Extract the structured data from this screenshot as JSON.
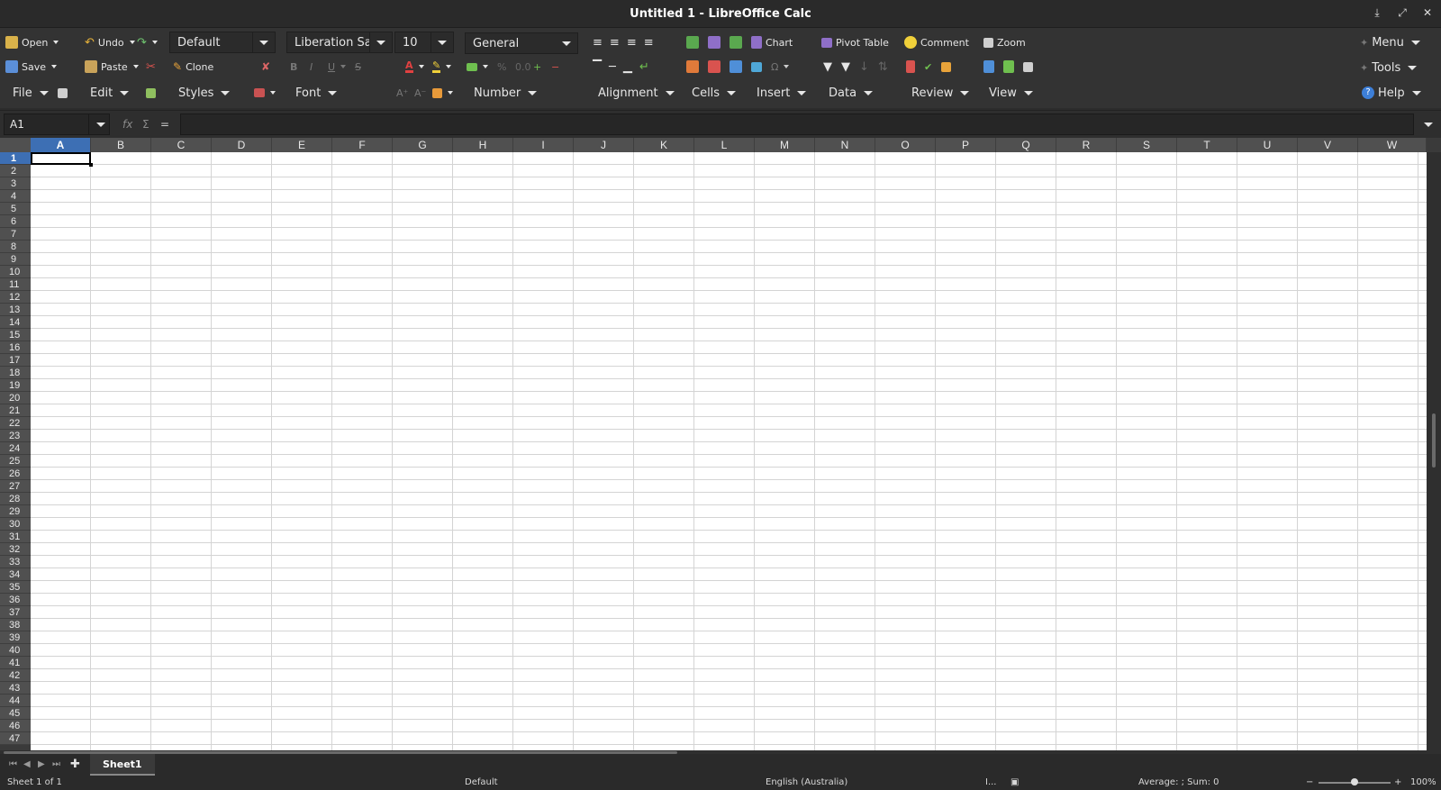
{
  "window": {
    "title": "Untitled 1 - LibreOffice Calc"
  },
  "notebookbar": {
    "file": {
      "open": "Open",
      "save": "Save",
      "menu": "File"
    },
    "edit": {
      "undo": "Undo",
      "paste": "Paste",
      "clone": "Clone",
      "menu": "Edit"
    },
    "styles": {
      "style_value": "Default",
      "menu": "Styles"
    },
    "font": {
      "name_value": "Liberation Sans",
      "size_value": "10",
      "menu": "Font"
    },
    "number": {
      "format_value": "General",
      "menu": "Number"
    },
    "alignment": {
      "menu": "Alignment"
    },
    "cells": {
      "menu": "Cells"
    },
    "insert": {
      "chart": "Chart",
      "menu": "Insert"
    },
    "data": {
      "pivot_table": "Pivot Table",
      "menu": "Data"
    },
    "review": {
      "comment": "Comment",
      "menu": "Review"
    },
    "view": {
      "zoom": "Zoom",
      "menu": "View"
    },
    "right": {
      "menu": "Menu",
      "tools": "Tools",
      "help": "Help"
    }
  },
  "formula_bar": {
    "name_box": "A1",
    "fx_label": "fx",
    "sigma_label": "Σ",
    "equals_label": "="
  },
  "sheet": {
    "columns": [
      "A",
      "B",
      "C",
      "D",
      "E",
      "F",
      "G",
      "H",
      "I",
      "J",
      "K",
      "L",
      "M",
      "N",
      "O",
      "P",
      "Q",
      "R",
      "S",
      "T",
      "U",
      "V",
      "W"
    ],
    "rows": [
      "1",
      "2",
      "3",
      "4",
      "5",
      "6",
      "7",
      "8",
      "9",
      "10",
      "11",
      "12",
      "13",
      "14",
      "15",
      "16",
      "17",
      "18",
      "19",
      "20",
      "21",
      "22",
      "23",
      "24",
      "25",
      "26",
      "27",
      "28",
      "29",
      "30",
      "31",
      "32",
      "33",
      "34",
      "35",
      "36",
      "37",
      "38",
      "39",
      "40",
      "41",
      "42",
      "43",
      "44",
      "45",
      "46",
      "47"
    ],
    "selected_column": "A",
    "selected_row": "1"
  },
  "tabs": {
    "sheets": [
      "Sheet1"
    ],
    "active": "Sheet1"
  },
  "status": {
    "sheet_info": "Sheet 1 of 1",
    "page_style": "Default",
    "language": "English (Australia)",
    "selection_mode": "I...",
    "summary": "Average: ; Sum: 0",
    "zoom": "100%"
  },
  "colors": {
    "accent": "#3d6fb4",
    "toolbar_bg": "#333333",
    "header_bg": "#505050"
  }
}
